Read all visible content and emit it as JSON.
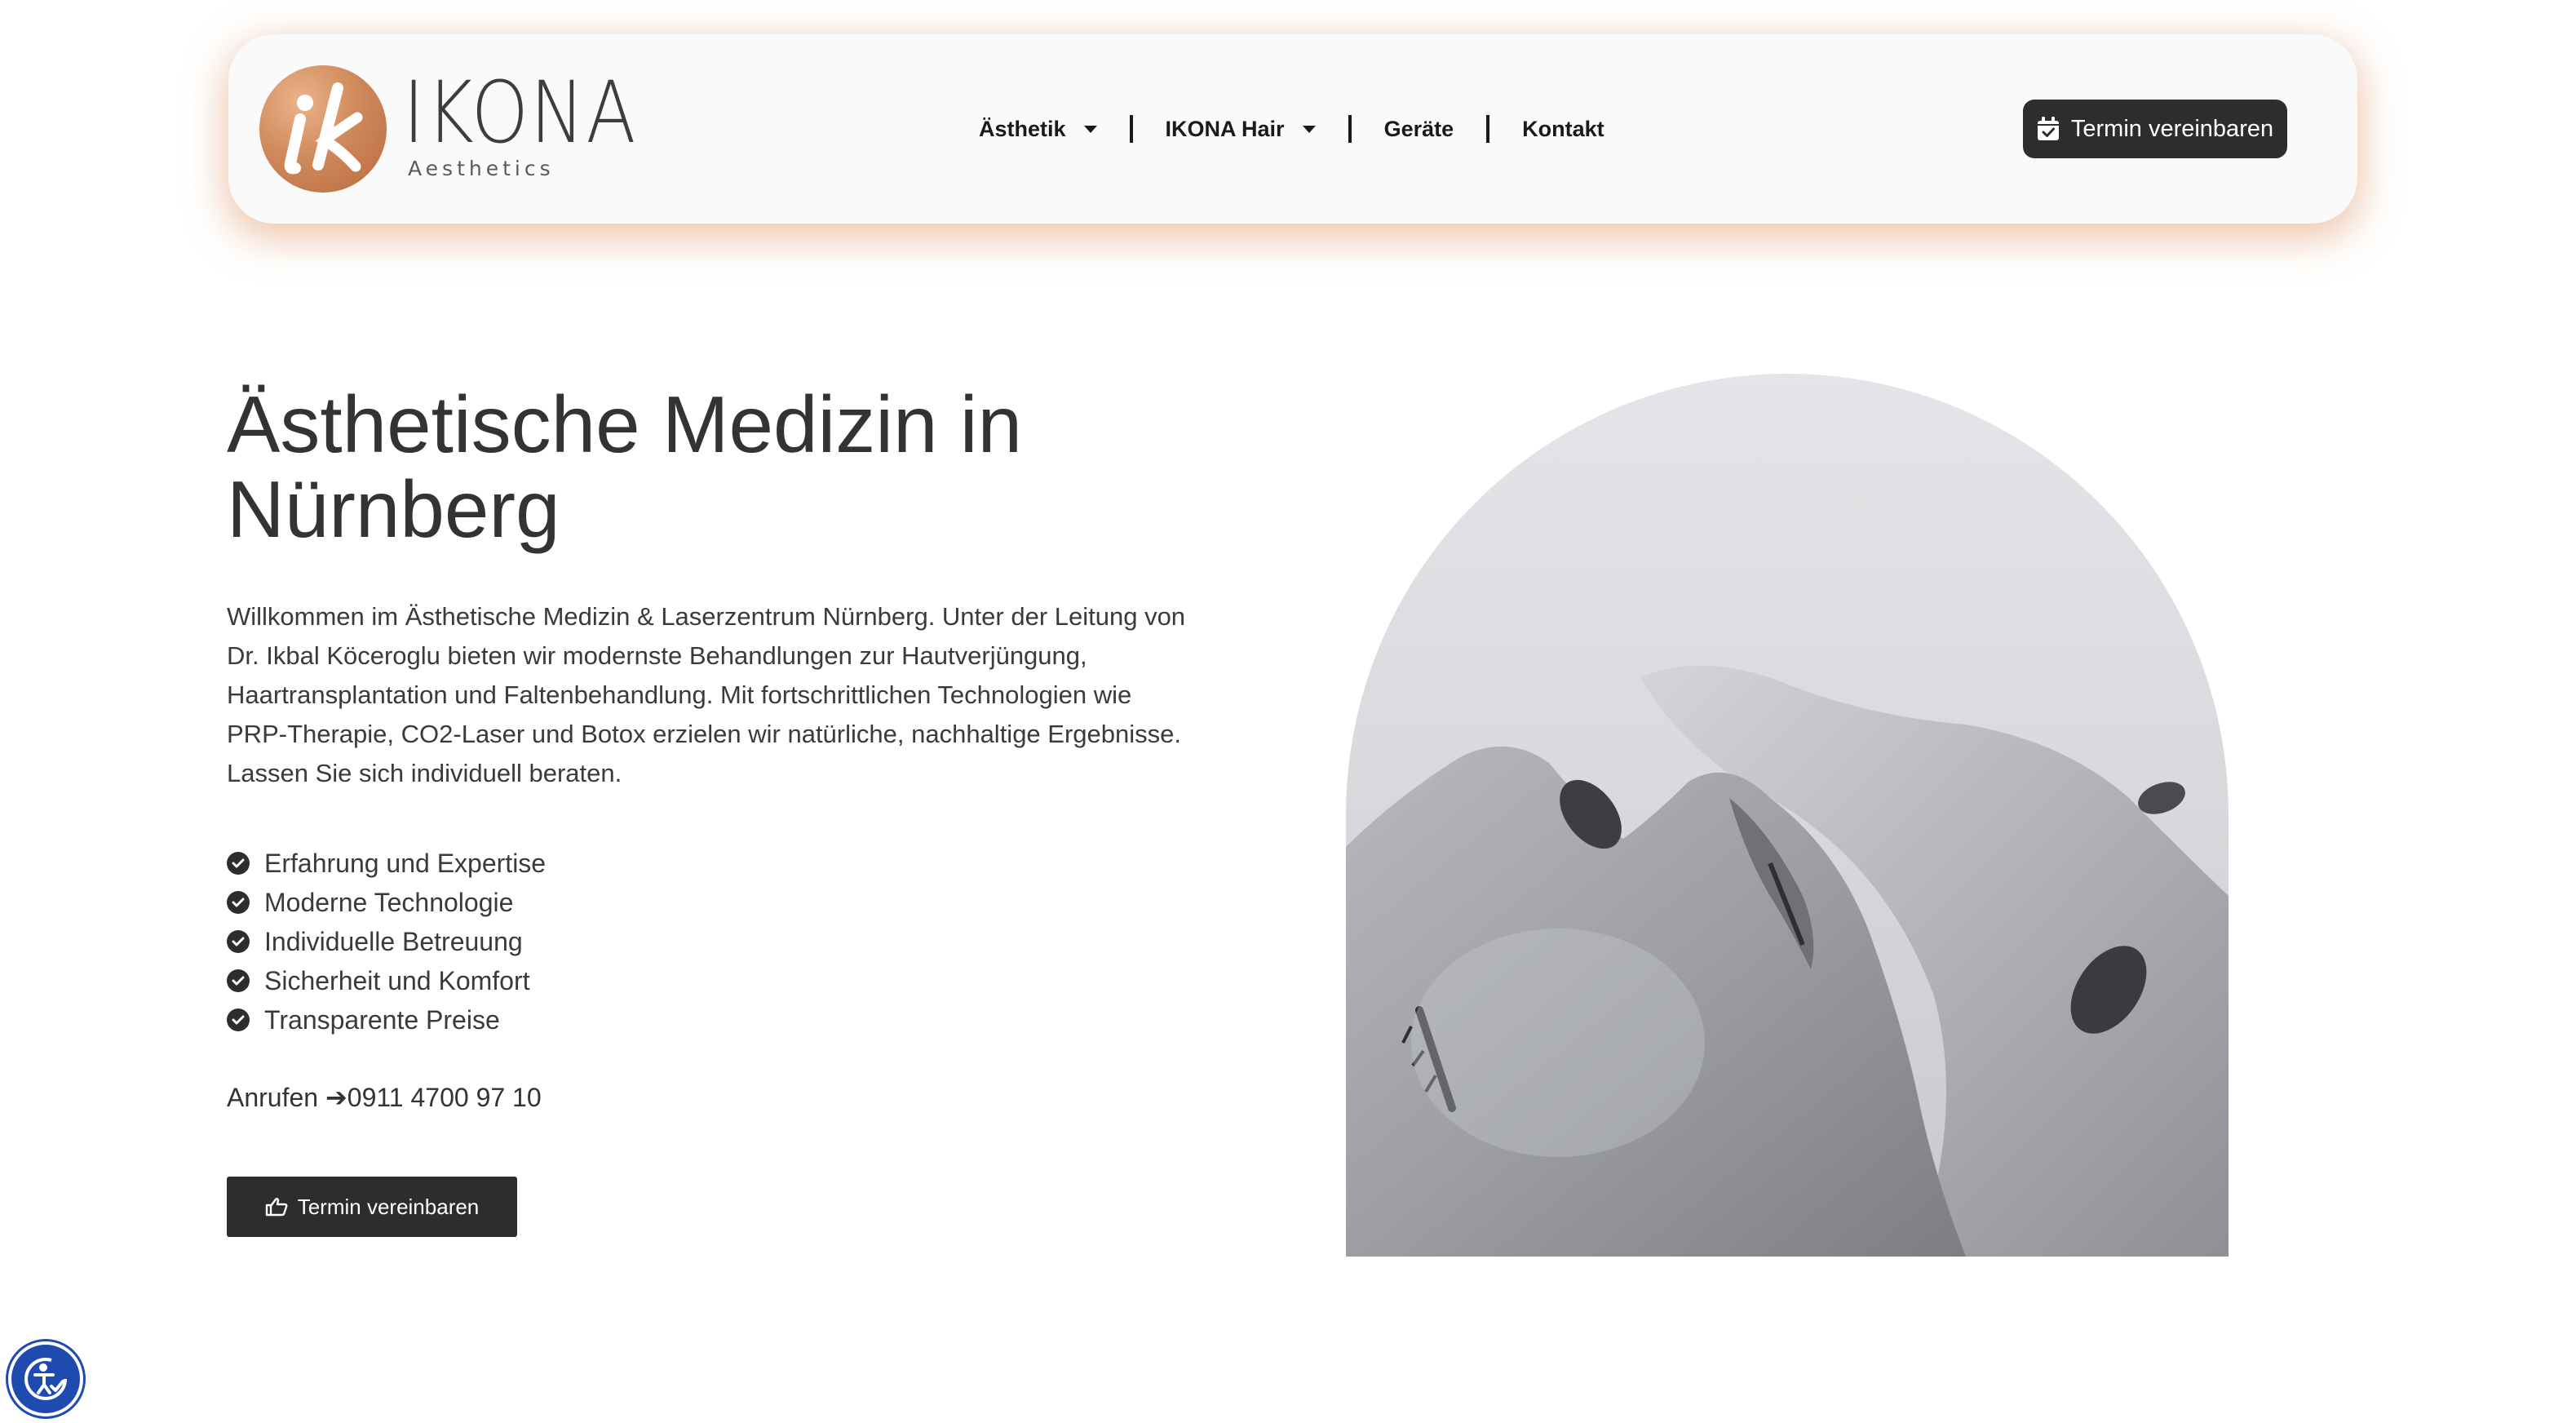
{
  "header": {
    "logo_mark": "ik",
    "logo_name": "IKONA",
    "logo_tagline": "Aesthetics",
    "nav": [
      {
        "label": "Ästhetik",
        "has_dropdown": true
      },
      {
        "label": "IKONA Hair",
        "has_dropdown": true
      },
      {
        "label": "Geräte",
        "has_dropdown": false
      },
      {
        "label": "Kontakt",
        "has_dropdown": false
      }
    ],
    "cta_label": "Termin vereinbaren",
    "cta_icon": "calendar-check-icon"
  },
  "hero": {
    "title_line1": "Ästhetische Medizin in",
    "title_line2": "Nürnberg",
    "intro": "Willkommen im Ästhetische Medizin & Laserzentrum Nürnberg. Unter der Leitung von Dr. Ikbal Köceroglu bieten wir modernste Behandlungen zur Hautverjüngung, Haartransplantation und Faltenbehandlung. Mit fortschrittlichen Technologien wie PRP-Therapie, CO2-Laser und Botox erzielen wir natürliche, nachhaltige Ergebnisse. Lassen Sie sich individuell beraten.",
    "features": [
      "Erfahrung und Expertise",
      "Moderne Technologie",
      "Individuelle Betreuung",
      "Sicherheit und Komfort",
      "Transparente Preise"
    ],
    "phone_label": "Anrufen ➔",
    "phone_number": "0911 4700 97 10",
    "button_label": "Termin vereinbaren",
    "button_icon": "hand-pointing-icon",
    "image_icon": "faces-photo"
  },
  "accessibility_icon": "accessibility-icon",
  "colors": {
    "brand_copper": "#c98558",
    "button_dark": "#2d2d2d",
    "text": "#333333",
    "accessibility_blue": "#1f4bb0"
  }
}
